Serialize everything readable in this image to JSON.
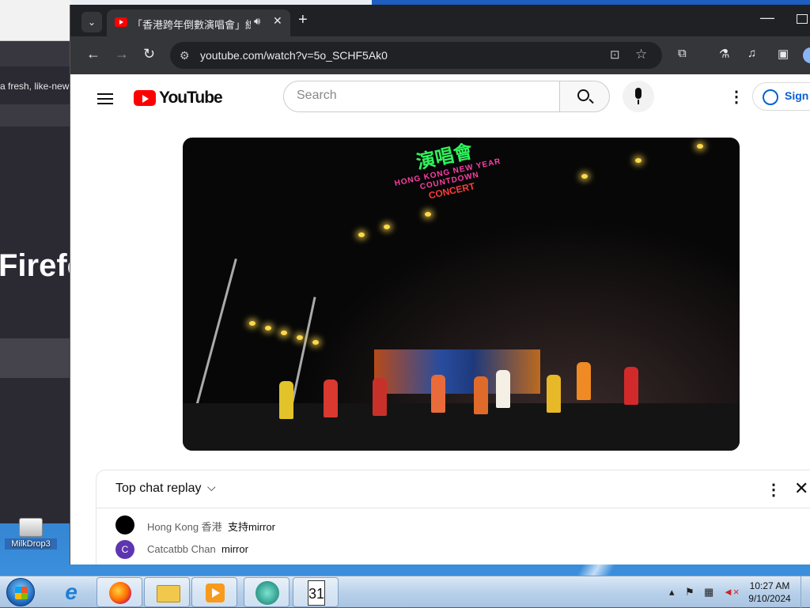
{
  "background_window": {
    "snippet": "a fresh, like-new",
    "app_name_partial": "Firefo"
  },
  "desktop_icon": {
    "label": "MilkDrop3"
  },
  "browser": {
    "tab": {
      "title": "「香港跨年倒數演唱會」線上",
      "audio_icon": "speaker-icon"
    },
    "address_bar": {
      "url": "youtube.com/watch?v=5o_SCHF5Ak0"
    }
  },
  "youtube": {
    "logo_text": "YouTube",
    "search": {
      "placeholder": "Search"
    },
    "sign_in_label": "Sign"
  },
  "video": {
    "sign_chinese": "演唱會",
    "sign_english": "HONG KONG NEW YEAR COUNTDOWN",
    "sign_concert": "CONCERT"
  },
  "chat": {
    "title": "Top chat replay",
    "messages": [
      {
        "author": "Hong Kong 香港",
        "text": "支持mirror",
        "avatar_letter": "",
        "avatar_color": "#000000"
      },
      {
        "author": "Catcatbb Chan",
        "text": "mirror",
        "avatar_letter": "C",
        "avatar_color": "#5e35b1"
      }
    ]
  },
  "taskbar": {
    "clock": {
      "time": "10:27 AM",
      "date": "9/10/2024"
    }
  }
}
